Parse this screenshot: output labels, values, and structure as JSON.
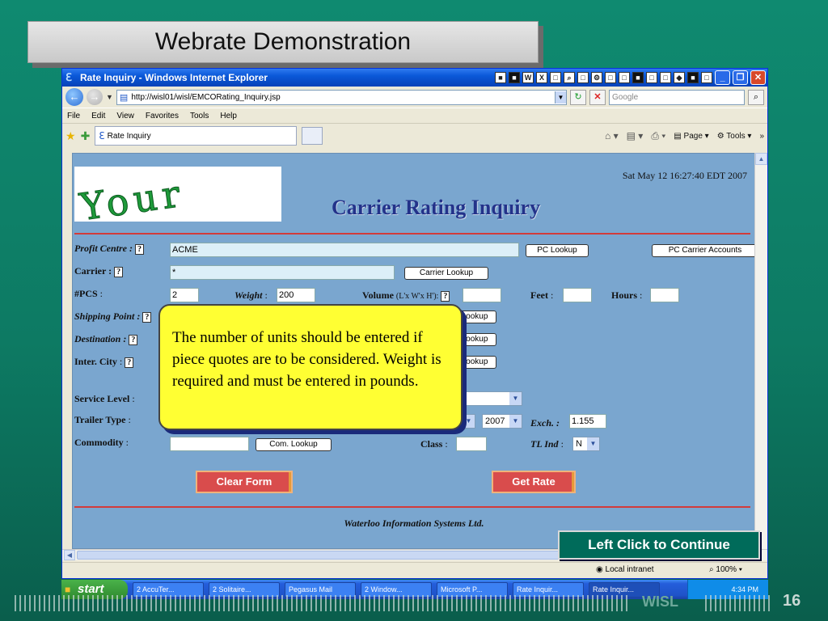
{
  "slide": {
    "title": "Webrate Demonstration",
    "brand": "WISL",
    "slide_number": "16",
    "continue_label": "Left Click to Continue"
  },
  "browser": {
    "window_title": "Rate Inquiry - Windows Internet Explorer",
    "address": "http://wisl01/wisl/EMCORating_Inquiry.jsp",
    "search_placeholder": "Google",
    "menu": [
      "File",
      "Edit",
      "View",
      "Favorites",
      "Tools",
      "Help"
    ],
    "tab_label": "Rate Inquiry",
    "cmd_page": "Page",
    "cmd_tools": "Tools",
    "status_zone": "Local intranet",
    "status_zoom": "100%"
  },
  "page": {
    "timestamp": "Sat May 12 16:27:40 EDT 2007",
    "heading": "Carrier Rating Inquiry",
    "footer": "Waterloo Information Systems Ltd.",
    "profit_centre": {
      "label": "Profit Centre :",
      "value": "ACME",
      "button": "PC Lookup",
      "accounts_button": "PC Carrier Accounts"
    },
    "carrier": {
      "label": "Carrier :",
      "value": "*",
      "button": "Carrier Lookup"
    },
    "pcs": {
      "label": "#PCS",
      "value": "2"
    },
    "weight": {
      "label": "Weight",
      "value": "200"
    },
    "volume": {
      "label": "Volume",
      "hint": "(L'x W'x H'):",
      "value": ""
    },
    "feet": {
      "label": "Feet",
      "value": ""
    },
    "hours": {
      "label": "Hours",
      "value": ""
    },
    "shipping_point": {
      "label": "Shipping Point :",
      "button": "Lookup"
    },
    "destination": {
      "label": "Destination :",
      "button": "Lookup"
    },
    "inter_city": {
      "label": "Inter. City",
      "button": "Lookup"
    },
    "service_level": {
      "label": "Service Level"
    },
    "trailer_type": {
      "label": "Trailer Type"
    },
    "year_value": "2007",
    "exch": {
      "label": "Exch. :",
      "value": "1.155"
    },
    "commodity": {
      "label": "Commodity",
      "value": "",
      "button": "Com. Lookup"
    },
    "class": {
      "label": "Class",
      "value": ""
    },
    "tl_ind": {
      "label": "TL Ind",
      "value": "N"
    },
    "clear_button": "Clear Form",
    "get_rate_button": "Get Rate"
  },
  "callout": {
    "text": "The number of units should be entered if piece quotes are to be considered. Weight is required and must be entered in pounds."
  },
  "taskbar": {
    "start": "start",
    "tasks": [
      "2 AccuTer...",
      "2 Solitaire...",
      "Pegasus Mail",
      "2 Window...",
      "Microsoft P...",
      "Rate Inquir...",
      "Rate Inquir..."
    ],
    "clock": "4:34 PM"
  }
}
